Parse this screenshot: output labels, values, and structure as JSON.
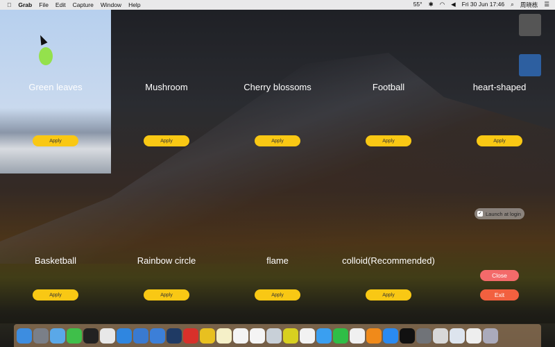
{
  "menubar": {
    "app": "Grab",
    "items": [
      "File",
      "Edit",
      "Capture",
      "Window",
      "Help"
    ],
    "temp": "55°",
    "datetime": "Fri 30 Jun  17:46",
    "user": "周晓栋"
  },
  "effects": [
    {
      "label": "Green leaves",
      "apply": "Apply"
    },
    {
      "label": "Mushroom",
      "apply": "Apply"
    },
    {
      "label": "Cherry blossoms",
      "apply": "Apply"
    },
    {
      "label": "Football",
      "apply": "Apply"
    },
    {
      "label": "heart-shaped",
      "apply": "Apply"
    },
    {
      "label": "Basketball",
      "apply": "Apply"
    },
    {
      "label": "Rainbow circle",
      "apply": "Apply"
    },
    {
      "label": "flame",
      "apply": "Apply"
    },
    {
      "label": "colloid(Recommended)",
      "apply": "Apply"
    }
  ],
  "launch_at_login": {
    "label": "Launch at login",
    "checked": true
  },
  "close_label": "Close",
  "exit_label": "Exit",
  "colors": {
    "apply": "#f9c814",
    "close": "#f36a6a",
    "exit": "#f2603f"
  },
  "dock": [
    "finder",
    "launchpad",
    "qq-browser",
    "wechat",
    "qq",
    "chrome",
    "safari",
    "xcode",
    "simulator",
    "sourcetree",
    "foxit",
    "cyberduck",
    "notes",
    "calendar",
    "reminders",
    "preview",
    "qq-music",
    "photos",
    "messages",
    "facetime",
    "itunes",
    "ibooks",
    "app-store",
    "terminal",
    "system-preferences",
    "grab",
    "document",
    "file",
    "trash"
  ]
}
